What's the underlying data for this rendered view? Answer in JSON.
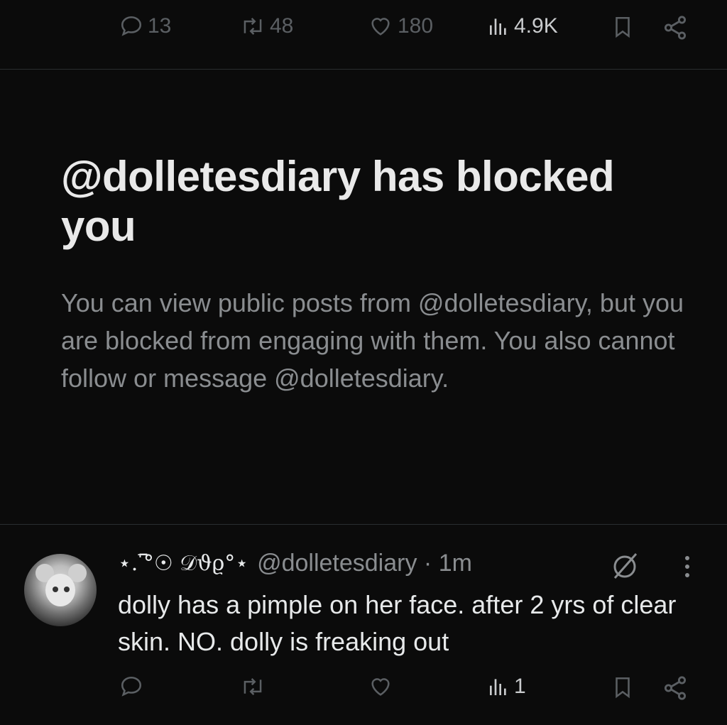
{
  "top_actions": {
    "replies": "13",
    "reposts": "48",
    "likes": "180",
    "views": "4.9K"
  },
  "blocked": {
    "title": "@dolletesdiary has blocked you",
    "body": "You can view public posts from @dolletesdiary, but you are blocked from engaging with them. You also cannot follow or message @dolletesdiary."
  },
  "post": {
    "display_name": "⋆. ̅͆°☉ 𝒟ϑϱ°⋆",
    "handle": "@dolletesdiary",
    "time": "1m",
    "text": "dolly has a pimple on her face. after 2 yrs of clear skin. NO. dolly is freaking out",
    "views": "1"
  },
  "colors": {
    "background": "#0b0b0b",
    "text_primary": "#e7e9ea",
    "text_secondary": "#8a8d90",
    "icon_muted": "#5b5f63"
  },
  "icons": [
    "reply-icon",
    "repost-icon",
    "like-icon",
    "views-icon",
    "bookmark-icon",
    "share-icon",
    "no-entry-icon",
    "more-icon"
  ]
}
